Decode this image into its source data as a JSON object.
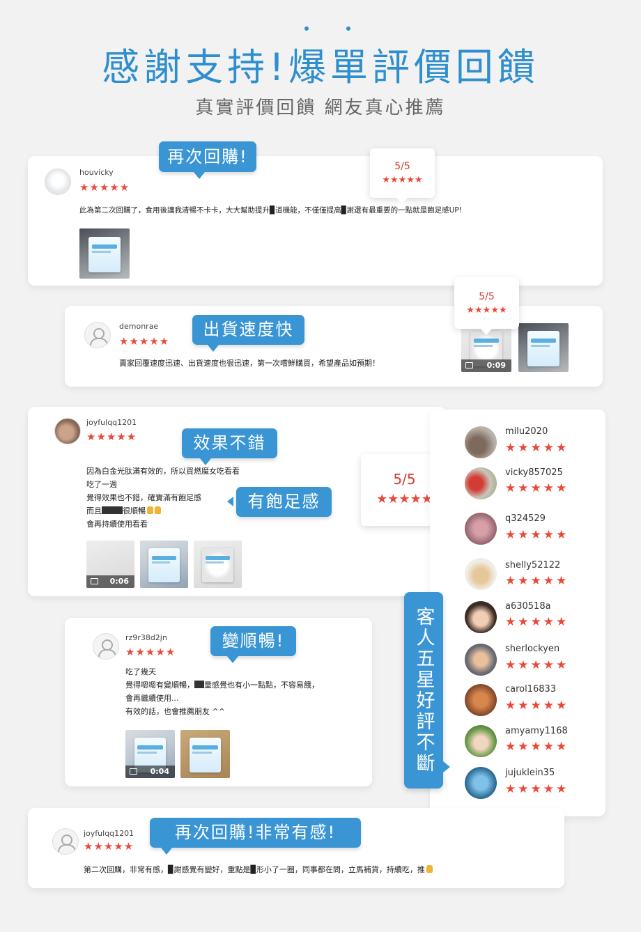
{
  "header": {
    "title": "感謝支持!爆單評價回饋",
    "subtitle": "真實評價回饋 網友真心推薦"
  },
  "stars": "★★★★★",
  "reviews": [
    {
      "user": "houvicky",
      "tag": "再次回購!",
      "score": "5/5",
      "text": "此為第二次回購了，食用後讓我清暢不卡卡，大大幫助提升▉道機能，不僅僅提高▉謝還有最重要的一點就是飽足感UP!"
    },
    {
      "user": "demonrae",
      "tag": "出貨速度快",
      "score": "5/5",
      "text": "賣家回覆速度迅速、出貨速度也很迅速，第一次嚐鮮購買，希望產品如預期！",
      "video_duration": "0:09"
    },
    {
      "user": "joyfulqq1201",
      "tag": "效果不錯",
      "tag2": "有飽足感",
      "score": "5/5",
      "lines": [
        "因為白金光肽滿有效的，所以買燃魔女吃看看",
        "吃了一週",
        "覺得效果也不錯，確實滿有飽足感",
        "而且",
        "很順暢",
        "會再持續使用看看"
      ],
      "video_duration": "0:06"
    },
    {
      "user": "rz9r38d2jn",
      "tag": "變順暢!",
      "lines": [
        "吃了幾天",
        "覺得嗯嗯有變順暢，",
        "量感覺也有小一點點，不容易餓，",
        "會再繼續使用...",
        "有效的話，也會推薦朋友 ^^"
      ],
      "video_duration": "0:04"
    },
    {
      "user": "joyfulqq1201",
      "tag": "再次回購!非常有感!",
      "text": "第二次回購，非常有感，▉謝感覺有變好，重點是▉形小了一圈，同事都在問，立馬補貨，持續吃，推"
    }
  ],
  "sidebar": {
    "label": "客人五星好評不斷",
    "users": [
      "milu2020",
      "vicky857025",
      "q324529",
      "shelly52122",
      "a630518a",
      "sherlockyen",
      "carol16833",
      "amyamy1168",
      "jujuklein35"
    ]
  },
  "colors": {
    "accent": "#3a95d5",
    "star": "#e84a3a",
    "score": "#d63b2e"
  }
}
